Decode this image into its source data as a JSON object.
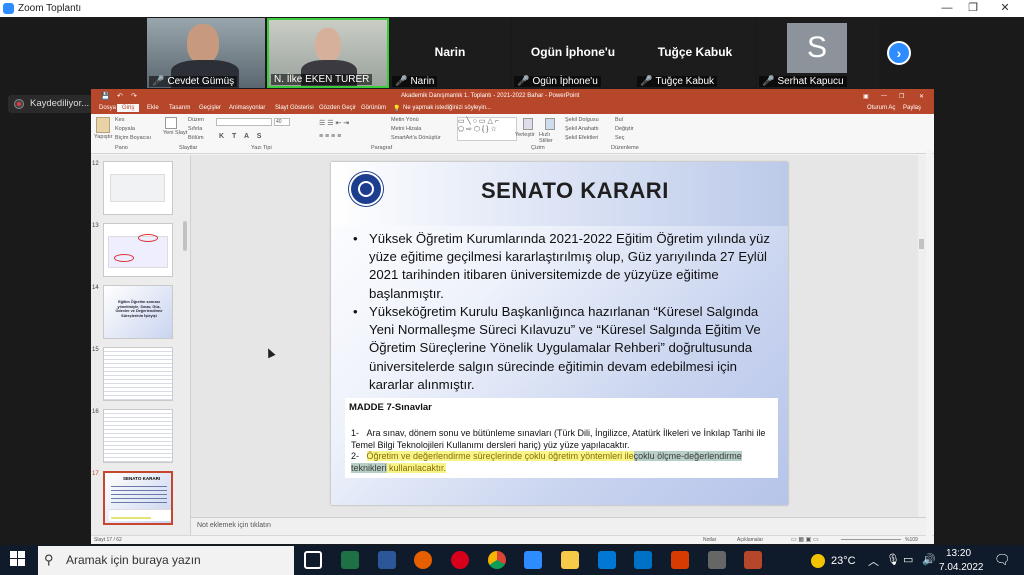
{
  "zoom": {
    "window_title": "Zoom Toplantı",
    "recording_label": "Kaydediliyor...",
    "participants": [
      {
        "name": "Cevdet Gümüş",
        "video": true,
        "muted": true
      },
      {
        "name": "N. İlke EKEN TURER",
        "video": true,
        "muted": false,
        "active_speaker": true
      },
      {
        "name": "Narin",
        "video": false,
        "muted": true
      },
      {
        "name": "Ogün İphone'u",
        "video": false,
        "muted": true
      },
      {
        "name": "Tuğçe Kabuk",
        "video": false,
        "muted": true
      },
      {
        "name": "Serhat Kapucu",
        "video": false,
        "muted": true,
        "avatar_letter": "S"
      }
    ],
    "next_icon": "chevron-right-icon",
    "accent": "#2d8cff"
  },
  "ppt": {
    "title": "Akademik Danışmanlık 1. Toplantı - 2021-2022 Bahar - PowerPoint",
    "account": "Oturum Aç",
    "share": "Paylaş",
    "tabs": [
      "Dosya",
      "Giriş",
      "Ekle",
      "Tasarım",
      "Geçişler",
      "Animasyonlar",
      "Slayt Gösterisi",
      "Gözden Geçir",
      "Görünüm"
    ],
    "tellme": "Ne yapmak istediğinizi söyleyin...",
    "ribbon_groups": [
      "Pano",
      "Slaytlar",
      "Yazı Tipi",
      "Paragraf",
      "Çizim",
      "Düzenleme"
    ],
    "ribbon": {
      "paste": "Yapıştır",
      "cut": "Kes",
      "copy": "Kopyala",
      "format_painter": "Biçim Boyacısı",
      "new_slide": "Yeni Slayt",
      "layout": "Düzen",
      "reset": "Sıfırla",
      "section": "Bölüm",
      "text_direction": "Metin Yönü",
      "align_text": "Metni Hizala",
      "smartart": "SmartArt'a Dönüştür",
      "arrange": "Yerleştir",
      "quick_styles": "Hızlı Stiller",
      "shape_fill": "Şekil Dolgusu",
      "shape_outline": "Şekil Anahattı",
      "shape_effects": "Şekil Efektleri",
      "find": "Bul",
      "replace": "Değiştir",
      "select": "Seç",
      "font_size": "40"
    },
    "thumbnails": [
      {
        "num": "12"
      },
      {
        "num": "13"
      },
      {
        "num": "14",
        "text": "Eğitim Öğretim sonrası yönetimiyle, Sınav, Güz, Ödevler ve Değerlendirme Süreçlerinin İşleyişi"
      },
      {
        "num": "15"
      },
      {
        "num": "16"
      },
      {
        "num": "17",
        "text": "SENATO KARARI",
        "selected": true
      }
    ],
    "notes_placeholder": "Not eklemek için tıklatın",
    "status": {
      "slide": "Slayt 17 / 62",
      "notes": "Notlar",
      "comments": "Açıklamalar",
      "zoom": "%109"
    }
  },
  "slide": {
    "title": "SENATO KARARI",
    "bullets": [
      "Yüksek Öğretim Kurumlarında 2021-2022 Eğitim Öğretim yılında yüz yüze eğitime geçilmesi kararlaştırılmış olup, Güz yarıyılında 27 Eylül 2021 tarihinden itibaren üniversitemizde de yüzyüze eğitime başlanmıştır.",
      "Yükseköğretim Kurulu Başkanlığınca hazırlanan “Küresel Salgında Yeni Normalleşme Süreci Kılavuzu” ve “Küresel Salgında Eğitim Ve Öğretim Süreçlerine Yönelik Uygulamalar Rehberi” doğrultusunda üniversitelerde salgın sürecinde eğitimin devam edebilmesi için kararlar alınmıştır."
    ],
    "madde": {
      "heading": "MADDE 7-Sınavlar",
      "item1_num": "1-",
      "item1": "Ara sınav, dönem sonu ve bütünleme sınavları (Türk Dili, İngilizce, Atatürk İlkeleri ve İnkılap Tarihi ile Temel Bilgi Teknolojileri Kullanımı dersleri hariç) yüz yüze yapılacaktır.",
      "item2_num": "2-",
      "item2_a": "Öğretim ve değerlendirme süreçlerinde çoklu öğretim yöntemleri ile",
      "item2_b": "çoklu ölçme-değerlendirme teknikleri",
      "item2_c": " kullanılacaktır."
    }
  },
  "taskbar": {
    "search_placeholder": "Aramak için buraya yazın",
    "weather": "23°C",
    "time": "13:20",
    "date": "7.04.2022"
  }
}
